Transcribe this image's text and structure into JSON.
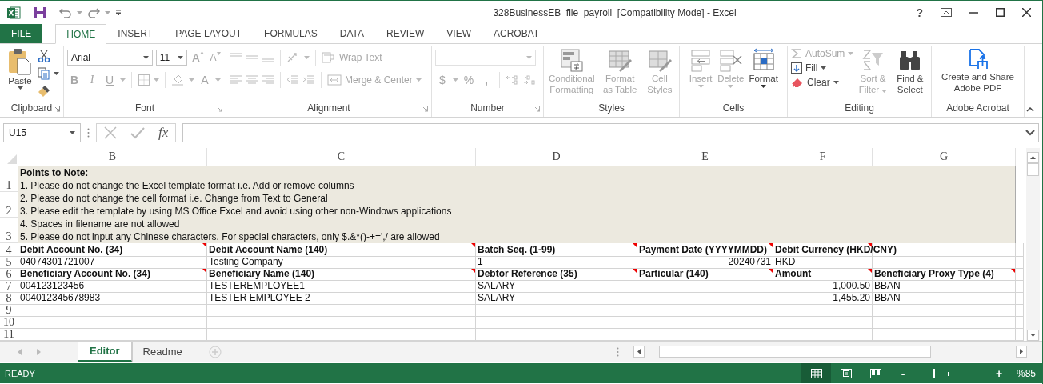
{
  "title_bar": {
    "title": "328BusinessEB_file_payroll  [Compatibility Mode] - Excel",
    "help": "?"
  },
  "ribbon_tabs": [
    {
      "label": "FILE",
      "kind": "file",
      "selected": false
    },
    {
      "label": "HOME",
      "kind": "tab",
      "selected": true
    },
    {
      "label": "INSERT",
      "kind": "tab",
      "selected": false
    },
    {
      "label": "PAGE LAYOUT",
      "kind": "tab",
      "selected": false
    },
    {
      "label": "FORMULAS",
      "kind": "tab",
      "selected": false
    },
    {
      "label": "DATA",
      "kind": "tab",
      "selected": false
    },
    {
      "label": "REVIEW",
      "kind": "tab",
      "selected": false
    },
    {
      "label": "VIEW",
      "kind": "tab",
      "selected": false
    },
    {
      "label": "ACROBAT",
      "kind": "tab",
      "selected": false
    }
  ],
  "ribbon": {
    "clipboard": {
      "paste": "Paste",
      "label": "Clipboard"
    },
    "font": {
      "font_name": "Arial",
      "font_size": "11",
      "size_buttons": [
        "A",
        "A"
      ],
      "style_buttons": [
        "B",
        "I",
        "U"
      ],
      "font_color": "A",
      "label": "Font"
    },
    "alignment": {
      "wrap_text": "Wrap Text",
      "merge": "Merge & Center",
      "label": "Alignment"
    },
    "number": {
      "symbols": [
        "$",
        "%",
        ","
      ],
      "label": "Number"
    },
    "styles": {
      "label": "Styles",
      "commands": [
        {
          "label": "Conditional Formatting",
          "disabled": true
        },
        {
          "label": "Format as Table",
          "disabled": true
        },
        {
          "label": "Cell Styles",
          "disabled": true
        }
      ]
    },
    "cells": {
      "label": "Cells",
      "commands": [
        {
          "label": "Insert",
          "disabled": true
        },
        {
          "label": "Delete",
          "disabled": true
        },
        {
          "label": "Format",
          "disabled": false
        }
      ]
    },
    "editing": {
      "label": "Editing",
      "commands": [
        {
          "label": "AutoSum",
          "kind": "autosum",
          "disabled": true
        },
        {
          "label": "Fill",
          "kind": "fill",
          "disabled": false
        },
        {
          "label": "Clear",
          "kind": "clear",
          "disabled": false
        },
        {
          "label": "Sort & Filter",
          "kind": "sort",
          "disabled": true
        },
        {
          "label": "Find & Select",
          "kind": "find",
          "disabled": false
        }
      ]
    },
    "acrobat": {
      "command": "Create and Share Adobe PDF",
      "label": "Adobe Acrobat"
    }
  },
  "formula_bar": {
    "name_box": "U15",
    "function_label": "fx"
  },
  "sheet": {
    "columns": [
      "B",
      "C",
      "D",
      "E",
      "F",
      "G"
    ],
    "notes": {
      "row_numbers": [
        "1",
        "2",
        "3"
      ],
      "title": "Points to Note:",
      "lines": [
        "1. Please do not change the Excel template format i.e. Add or remove columns",
        "2. Please do not change the cell format i.e. Change from Text to General",
        "3. Please edit the template by using MS Office Excel and avoid using other non-Windows applications",
        "4. Spaces in filename are not allowed",
        "5. Please do not input any Chinese characters. For special characters, only $.&*()-+=',/ are allowed"
      ]
    },
    "rows": [
      {
        "number": "4",
        "kind": "header",
        "cells": [
          {
            "text": "Debit Account No. (34)",
            "comment": true
          },
          {
            "text": "Debit Account Name (140)",
            "comment": true
          },
          {
            "text": "Batch Seq. (1-99)",
            "comment": true
          },
          {
            "text": "Payment Date (YYYYMMDD)",
            "comment": true
          },
          {
            "text": "Debit Currency (HKD/CNY)",
            "comment": true
          },
          {}
        ]
      },
      {
        "number": "5",
        "kind": "data",
        "cells": [
          {
            "text": "04074301721007",
            "numeric": false
          },
          {
            "text": "Testing Company",
            "numeric": false
          },
          {
            "text": "1",
            "numeric": false
          },
          {
            "text": "20240731",
            "numeric": true
          },
          {
            "text": "HKD",
            "numeric": false
          },
          {}
        ]
      },
      {
        "number": "6",
        "kind": "header",
        "cells": [
          {
            "text": "Beneficiary Account No. (34)",
            "comment": true
          },
          {
            "text": "Beneficiary Name (140)",
            "comment": true
          },
          {
            "text": "Debtor Reference (35)",
            "comment": true
          },
          {
            "text": "Particular (140)",
            "comment": true
          },
          {
            "text": "Amount",
            "comment": true
          },
          {
            "text": "Beneficiary Proxy Type (4)",
            "comment": true
          }
        ]
      },
      {
        "number": "7",
        "kind": "data",
        "cells": [
          {
            "text": "004123123456",
            "numeric": false
          },
          {
            "text": "TESTEREMPLOYEE1",
            "numeric": false
          },
          {
            "text": "SALARY",
            "numeric": false
          },
          {},
          {
            "text": "1,000.50",
            "numeric": true
          },
          {
            "text": "BBAN",
            "numeric": false
          }
        ]
      },
      {
        "number": "8",
        "kind": "data",
        "cells": [
          {
            "text": "004012345678983",
            "numeric": false
          },
          {
            "text": "TESTER EMPLOYEE 2",
            "numeric": false
          },
          {
            "text": "SALARY",
            "numeric": false
          },
          {},
          {
            "text": "1,455.20",
            "numeric": true
          },
          {
            "text": "BBAN",
            "numeric": false
          }
        ]
      },
      {
        "number": "9",
        "kind": "data"
      },
      {
        "number": "10",
        "kind": "data"
      },
      {
        "number": "11",
        "kind": "data"
      }
    ]
  },
  "sheet_tabs": [
    {
      "label": "Editor",
      "selected": true
    },
    {
      "label": "Readme",
      "selected": false
    }
  ],
  "status_bar": {
    "status": "READY",
    "views": [
      {
        "kind": "normal",
        "selected": true
      },
      {
        "kind": "page_layout",
        "selected": false
      },
      {
        "kind": "page_break",
        "selected": false
      }
    ],
    "zoom": {
      "minus": "-",
      "plus": "+",
      "level": 0.3,
      "text": "%85"
    }
  }
}
